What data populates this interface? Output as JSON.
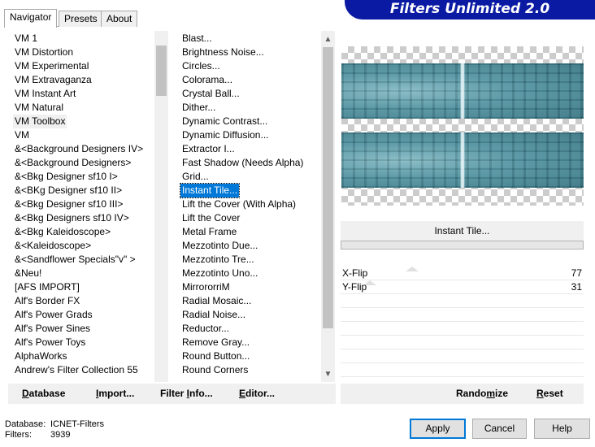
{
  "tabs": [
    {
      "label": "Navigator"
    },
    {
      "label": "Presets"
    },
    {
      "label": "About"
    }
  ],
  "banner_title": "Filters Unlimited 2.0",
  "categories": [
    "VM 1",
    "VM Distortion",
    "VM Experimental",
    "VM Extravaganza",
    "VM Instant Art",
    "VM Natural",
    "VM Toolbox",
    "VM",
    "&<Background Designers IV>",
    "&<Background Designers>",
    "&<Bkg Designer sf10 I>",
    "&<BKg Designer sf10 II>",
    "&<Bkg Designer sf10 III>",
    "&<Bkg Designers sf10 IV>",
    "&<Bkg Kaleidoscope>",
    "&<Kaleidoscope>",
    "&<Sandflower Specials\"v\" >",
    "&Neu!",
    "[AFS IMPORT]",
    "Alf's Border FX",
    "Alf's Power Grads",
    "Alf's Power Sines",
    "Alf's Power Toys",
    "AlphaWorks",
    "Andrew's Filter Collection 55"
  ],
  "selected_category": "VM Toolbox",
  "filters": [
    "Blast...",
    "Brightness Noise...",
    "Circles...",
    "Colorama...",
    "Crystal Ball...",
    "Dither...",
    "Dynamic Contrast...",
    "Dynamic Diffusion...",
    "Extractor I...",
    "Fast Shadow (Needs Alpha)",
    "Grid...",
    "Instant Tile...",
    "Lift the Cover (With Alpha)",
    "Lift the Cover",
    "Metal Frame",
    "Mezzotinto Due...",
    "Mezzotinto Tre...",
    "Mezzotinto Uno...",
    "MirrororriM",
    "Radial Mosaic...",
    "Radial Noise...",
    "Reductor...",
    "Remove Gray...",
    "Round Button...",
    "Round Corners"
  ],
  "selected_filter": "Instant Tile...",
  "current_filter_name": "Instant Tile...",
  "parameters": [
    {
      "label": "X-Flip",
      "value": "77"
    },
    {
      "label": "Y-Flip",
      "value": "31"
    }
  ],
  "left_toolbar": {
    "database": {
      "u": "D",
      "rest": "atabase"
    },
    "import": {
      "u": "I",
      "rest": "mport..."
    },
    "filter_info": {
      "pre": "Filter ",
      "u": "I",
      "rest": "nfo..."
    },
    "editor": {
      "u": "E",
      "rest": "ditor..."
    }
  },
  "right_toolbar": {
    "randomize": {
      "pre": "Rando",
      "u": "m",
      "rest": "ize"
    },
    "reset": {
      "u": "R",
      "rest": "eset"
    }
  },
  "status": {
    "database_label": "Database:",
    "database_value": "ICNET-Filters",
    "filters_label": "Filters:",
    "filters_value": "3939"
  },
  "buttons": {
    "apply": "Apply",
    "cancel": "Cancel",
    "help": "Help"
  },
  "colors": {
    "banner": "#0b1aa3",
    "selection": "#0078d7",
    "preview_teal": "#3f8290"
  }
}
